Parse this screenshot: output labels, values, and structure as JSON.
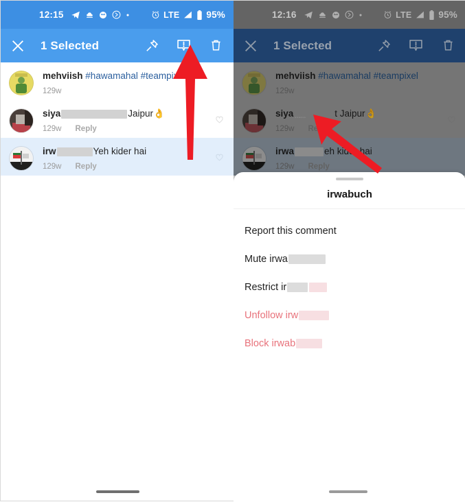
{
  "colors": {
    "accent_blue": "#4a9ded",
    "status_blue": "#3d8fe3",
    "dimmed_blue": "#28548c",
    "dimmed_grey": "#808080",
    "selected_row": "#e2eefb",
    "danger_red": "#e8727b",
    "arrow_red": "#ed1c24"
  },
  "left_phone": {
    "status_bar": {
      "time": "12:15",
      "left_icons": [
        "telegram-icon",
        "cloud-upload-icon",
        "smiley-icon",
        "circled-arrow-icon",
        "dot-icon"
      ],
      "right_icons": [
        "alarm-icon",
        "signal-icon",
        "battery-icon"
      ],
      "network": "LTE",
      "battery": "95%"
    },
    "action_bar": {
      "close_label": "close-icon",
      "title": "1 Selected",
      "actions": [
        "pin-icon",
        "report-icon",
        "delete-icon"
      ]
    },
    "comments": [
      {
        "username": "mehviish",
        "text": "#hawamahal #teampixel",
        "text_is_tag": true,
        "time": "129w",
        "reply": "",
        "selected": false,
        "redacted": false,
        "has_heart": false
      },
      {
        "username": "siya",
        "text": "Jaipur",
        "emoji": "👌",
        "time": "129w",
        "reply": "Reply",
        "selected": false,
        "redacted": true,
        "has_heart": true
      },
      {
        "username": "irw",
        "text": "Yeh kider hai",
        "time": "129w",
        "reply": "Reply",
        "selected": true,
        "redacted": true,
        "has_heart": true
      }
    ],
    "annotation": {
      "arrow_name": "red-arrow-pointing-to-report-icon",
      "points_to": "report-icon"
    }
  },
  "right_phone": {
    "status_bar": {
      "time": "12:16",
      "left_icons": [
        "telegram-icon",
        "cloud-upload-icon",
        "smiley-icon",
        "circled-arrow-icon",
        "dot-icon"
      ],
      "right_icons": [
        "alarm-icon",
        "signal-icon",
        "battery-icon"
      ],
      "network": "LTE",
      "battery": "95%"
    },
    "action_bar": {
      "close_label": "close-icon",
      "title": "1 Selected",
      "actions": [
        "pin-icon",
        "report-icon",
        "delete-icon"
      ]
    },
    "comments": [
      {
        "username": "mehviish",
        "text": "#hawamahal #teampixel",
        "text_is_tag": true,
        "time": "129w",
        "reply": "",
        "selected": false,
        "redacted": false,
        "has_heart": false
      },
      {
        "username": "siya",
        "text": "t Jaipur",
        "emoji": "👌",
        "time": "129w",
        "reply": "Reply",
        "selected": false,
        "redacted": true,
        "has_heart": true
      },
      {
        "username": "irwa",
        "text": "eh kider hai",
        "time": "129w",
        "reply": "Reply",
        "selected": true,
        "redacted": true,
        "has_heart": true
      }
    ],
    "bottom_sheet": {
      "handle": "drag-handle",
      "title": "irwabuch",
      "items": [
        {
          "label": "Report this comment",
          "danger": false,
          "redacted": false
        },
        {
          "label": "Mute irwa",
          "danger": false,
          "redacted": true
        },
        {
          "label": "Restrict ir",
          "danger": false,
          "redacted": true
        },
        {
          "label": "Unfollow irw",
          "danger": true,
          "redacted": true
        },
        {
          "label": "Block irwab",
          "danger": true,
          "redacted": true
        }
      ]
    },
    "annotation": {
      "arrow_name": "red-arrow-pointing-to-restrict-option",
      "points_to": "Restrict"
    }
  }
}
